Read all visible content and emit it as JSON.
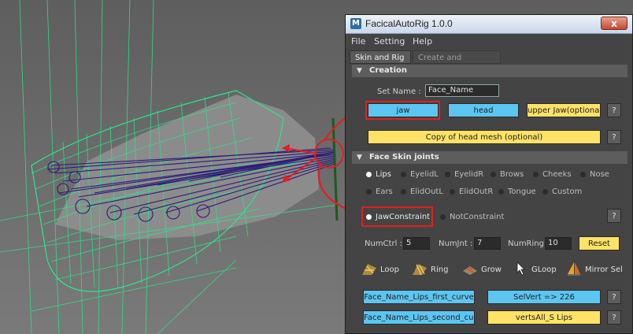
{
  "window": {
    "title": "FacicalAutoRig 1.0.0",
    "app_icon": "M",
    "close_glyph": "x"
  },
  "menu": [
    "File",
    "Setting",
    "Help"
  ],
  "tabs": {
    "active": "Skin and Rig",
    "inactive": "Create and Editing..."
  },
  "creation": {
    "header": "Creation",
    "set_name_label": "Set Name :",
    "set_name_value": "Face_Name",
    "jaw_button": "jaw",
    "head_button": "head",
    "upper_jaw_button": "upper Jaw(optional)",
    "help": "?",
    "copy_head_button": "Copy of head mesh (optional)"
  },
  "face_skin": {
    "header": "Face Skin joints",
    "parts_row1": [
      "Lips",
      "EyelidL",
      "EyelidR",
      "Brows",
      "Cheeks",
      "Nose"
    ],
    "parts_row2": [
      "Ears",
      "ElidOutL",
      "ElidOutR",
      "Tongue",
      "Custom"
    ],
    "selected_part": "Lips",
    "constraint_on": "JawConstraint",
    "constraint_off": "NotConstraint",
    "numctrl_label": "NumCtrl :",
    "numctrl_value": "5",
    "numjnt_label": "NumJnt :",
    "numjnt_value": "7",
    "numring_label": "NumRing :",
    "numring_value": "10",
    "reset_button": "Reset",
    "tools": [
      "Loop",
      "Ring",
      "Grow",
      "GLoop",
      "Mirror Sel"
    ],
    "curve1": "Face_Name_Lips_first_curve",
    "curve2": "Face_Name_Lips_second_curve",
    "selvert": "SelVert => 226",
    "verts_all": "vertsAll_S Lips"
  },
  "colors": {
    "blue_button": "#5cc6f2",
    "yellow_button": "#ffe266",
    "highlight": "#e02020",
    "wire": "#27e88a",
    "joint": "#2a1a6e"
  },
  "icons": [
    "close-icon",
    "collapse-arrow-icon",
    "loop-icon",
    "ring-icon",
    "grow-icon",
    "cursor-icon",
    "mirror-icon"
  ]
}
